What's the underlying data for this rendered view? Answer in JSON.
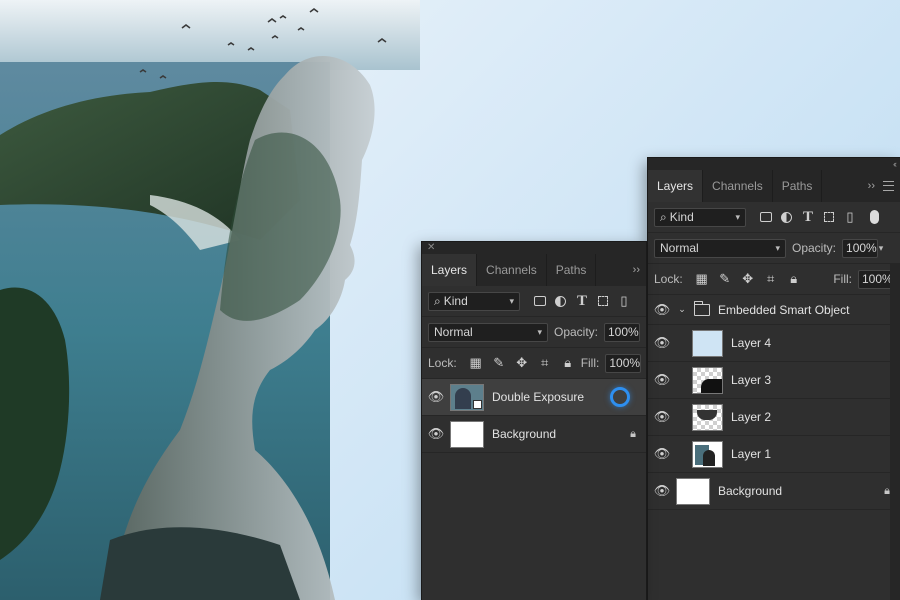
{
  "colors": {
    "panel_bg": "#2f2f2f",
    "accent_ring": "#2e8ff0",
    "sky": "#cfe4f4"
  },
  "front_panel": {
    "tabs": [
      {
        "label": "Layers",
        "active": true
      },
      {
        "label": "Channels",
        "active": false
      },
      {
        "label": "Paths",
        "active": false
      }
    ],
    "kind_label": "Kind",
    "blend_mode": "Normal",
    "opacity_label": "Opacity:",
    "opacity_value": "100%",
    "lock_label": "Lock:",
    "fill_label": "Fill:",
    "fill_value": "100%",
    "layers": [
      {
        "name": "Double Exposure",
        "selected": true,
        "type": "smart-object"
      },
      {
        "name": "Background",
        "selected": false,
        "locked": true
      }
    ]
  },
  "back_panel": {
    "tabs": [
      {
        "label": "Layers",
        "active": true
      },
      {
        "label": "Channels",
        "active": false
      },
      {
        "label": "Paths",
        "active": false
      }
    ],
    "kind_label": "Kind",
    "blend_mode": "Normal",
    "opacity_label": "Opacity:",
    "opacity_value": "100%",
    "lock_label": "Lock:",
    "fill_label": "Fill:",
    "fill_value": "100%",
    "group_name": "Embedded Smart Object",
    "layers": [
      {
        "name": "Layer 4"
      },
      {
        "name": "Layer 3"
      },
      {
        "name": "Layer 2"
      },
      {
        "name": "Layer 1"
      },
      {
        "name": "Background",
        "locked": true
      }
    ]
  }
}
